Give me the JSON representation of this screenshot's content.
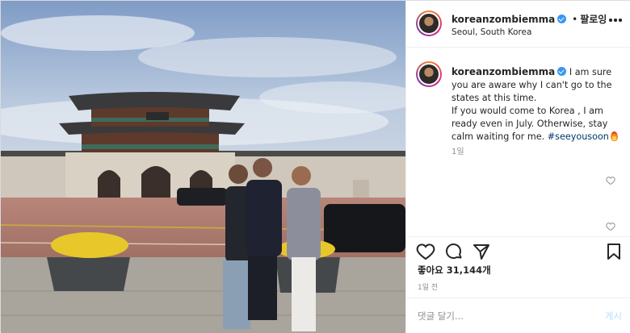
{
  "post": {
    "username": "koreanzombiemma",
    "follow_prefix": "•",
    "follow_label": "팔로잉",
    "location": "Seoul, South Korea",
    "photo_alt": "photo",
    "caption_line1": " I am sure you are aware why I can't go to the states at this time.",
    "caption_line2": "If you would come to Korea , I am ready even in July. Otherwise, stay calm waiting for me. ",
    "hashtag": "#seeyousoon",
    "caption_age": "1일",
    "likes_label": "좋아요",
    "likes_count": "31,144개",
    "post_age": "1일 전",
    "comment_placeholder": "댓글 달기...",
    "post_button": "게시"
  },
  "colors": {
    "verified": "#3897f0",
    "link": "#00376b",
    "post_button_disabled": "#b2dffc"
  },
  "icons": [
    "more-icon",
    "verified-icon",
    "heart-icon",
    "comment-icon",
    "share-icon",
    "bookmark-icon",
    "fire-emoji"
  ]
}
